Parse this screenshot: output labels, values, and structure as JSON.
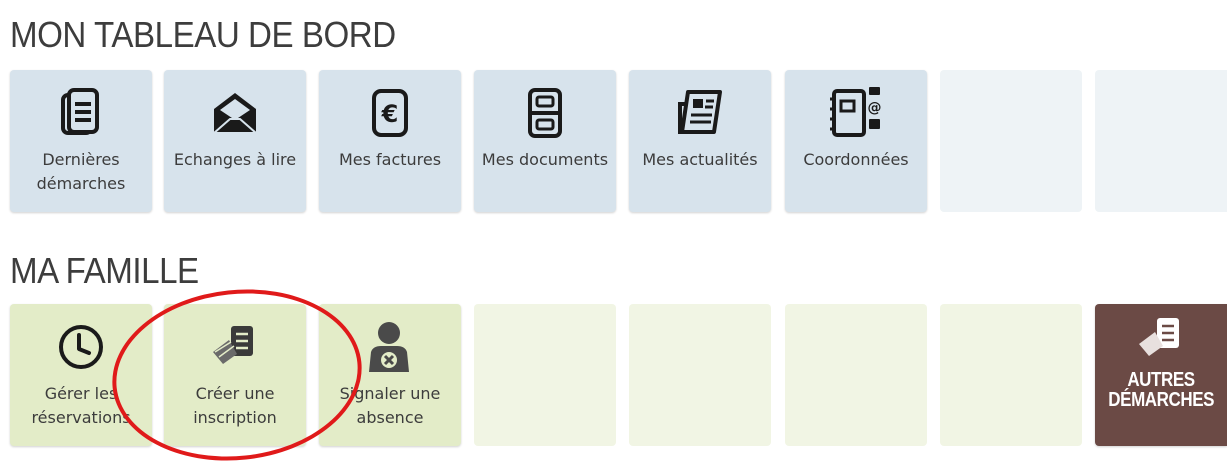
{
  "dashboard": {
    "title": "MON TABLEAU DE BORD",
    "tiles": [
      {
        "label": "Dernières démarches",
        "icon": "document-stack-icon"
      },
      {
        "label": "Echanges à lire",
        "icon": "open-envelope-icon"
      },
      {
        "label": "Mes factures",
        "icon": "euro-invoice-icon"
      },
      {
        "label": "Mes documents",
        "icon": "filing-cabinet-icon"
      },
      {
        "label": "Mes actualités",
        "icon": "newspaper-icon"
      },
      {
        "label": "Coordonnées",
        "icon": "address-book-icon"
      }
    ]
  },
  "famille": {
    "title": "MA FAMILLE",
    "tiles": [
      {
        "label": "Gérer les réservations",
        "icon": "clock-icon"
      },
      {
        "label": "Créer une inscription",
        "icon": "form-pen-icon"
      },
      {
        "label": "Signaler une absence",
        "icon": "person-absent-icon"
      }
    ],
    "autres": {
      "label": "AUTRES DÉMARCHES",
      "icon": "form-pen-icon"
    }
  },
  "colors": {
    "blue_tile": "#d7e3ec",
    "green_tile": "#e3ecc8",
    "brown_tile": "#6b4a45",
    "highlight_circle": "#e01a1a"
  }
}
